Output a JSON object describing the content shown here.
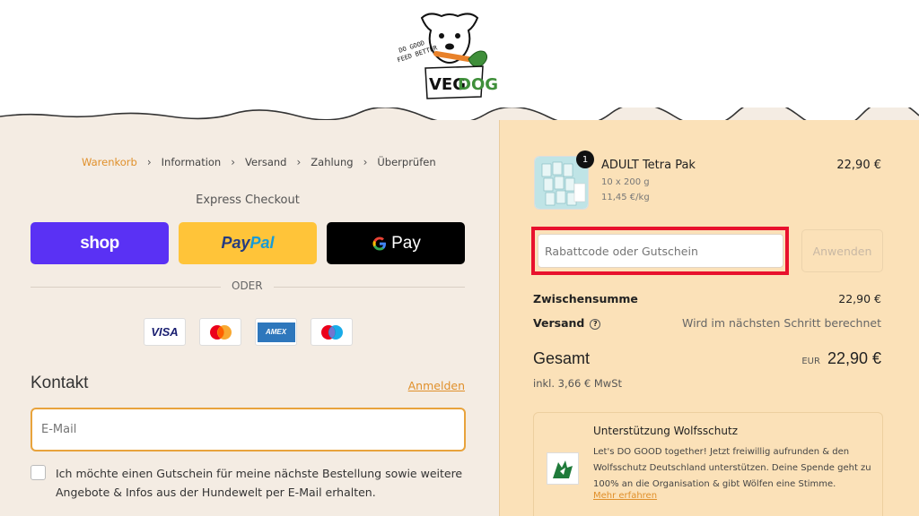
{
  "header": {
    "logo_text": "VEGDOG",
    "logo_tagline": "DO GOOD FEED BETTER"
  },
  "breadcrumb": {
    "items": [
      "Warenkorb",
      "Information",
      "Versand",
      "Zahlung",
      "Überprüfen"
    ],
    "separator": "›"
  },
  "express": {
    "title": "Express Checkout",
    "shop_label": "shop",
    "paypal_part1": "Pay",
    "paypal_part2": "Pal",
    "gpay_label": "Pay",
    "divider_label": "ODER"
  },
  "payment_cards": {
    "visa": "VISA",
    "amex": "AMEX"
  },
  "contact": {
    "title": "Kontakt",
    "login_link": "Anmelden",
    "email_placeholder": "E-Mail",
    "newsletter_label": "Ich möchte einen Gutschein für meine nächste Bestellung sowie weitere Angebote & Infos aus der Hundewelt per E-Mail erhalten."
  },
  "summary": {
    "product": {
      "name": "ADULT Tetra Pak",
      "size": "10 x 200 g",
      "unit_price": "11,45 €/kg",
      "price": "22,90 €",
      "quantity": "1"
    },
    "discount_placeholder": "Rabattcode oder Gutschein",
    "apply_label": "Anwenden",
    "subtotal_label": "Zwischensumme",
    "subtotal_value": "22,90 €",
    "shipping_label": "Versand",
    "shipping_value": "Wird im nächsten Schritt berechnet",
    "total_label": "Gesamt",
    "total_currency": "EUR",
    "total_value": "22,90 €",
    "tax_note": "inkl. 3,66 € MwSt"
  },
  "donation": {
    "title": "Unterstützung Wolfsschutz",
    "text": "Let's DO GOOD together! Jetzt freiwillig aufrunden & den Wolfsschutz Deutschland unterstützen. Deine Spende geht zu 100% an die Organisation & gibt Wölfen eine Stimme.",
    "link": "Mehr erfahren"
  },
  "colors": {
    "accent": "#e0902b",
    "highlight": "#e8112d",
    "summary_bg": "#fbe1b8",
    "page_bg": "#f4ece3",
    "shop_purple": "#5a31f4",
    "paypal_yellow": "#ffc439"
  }
}
